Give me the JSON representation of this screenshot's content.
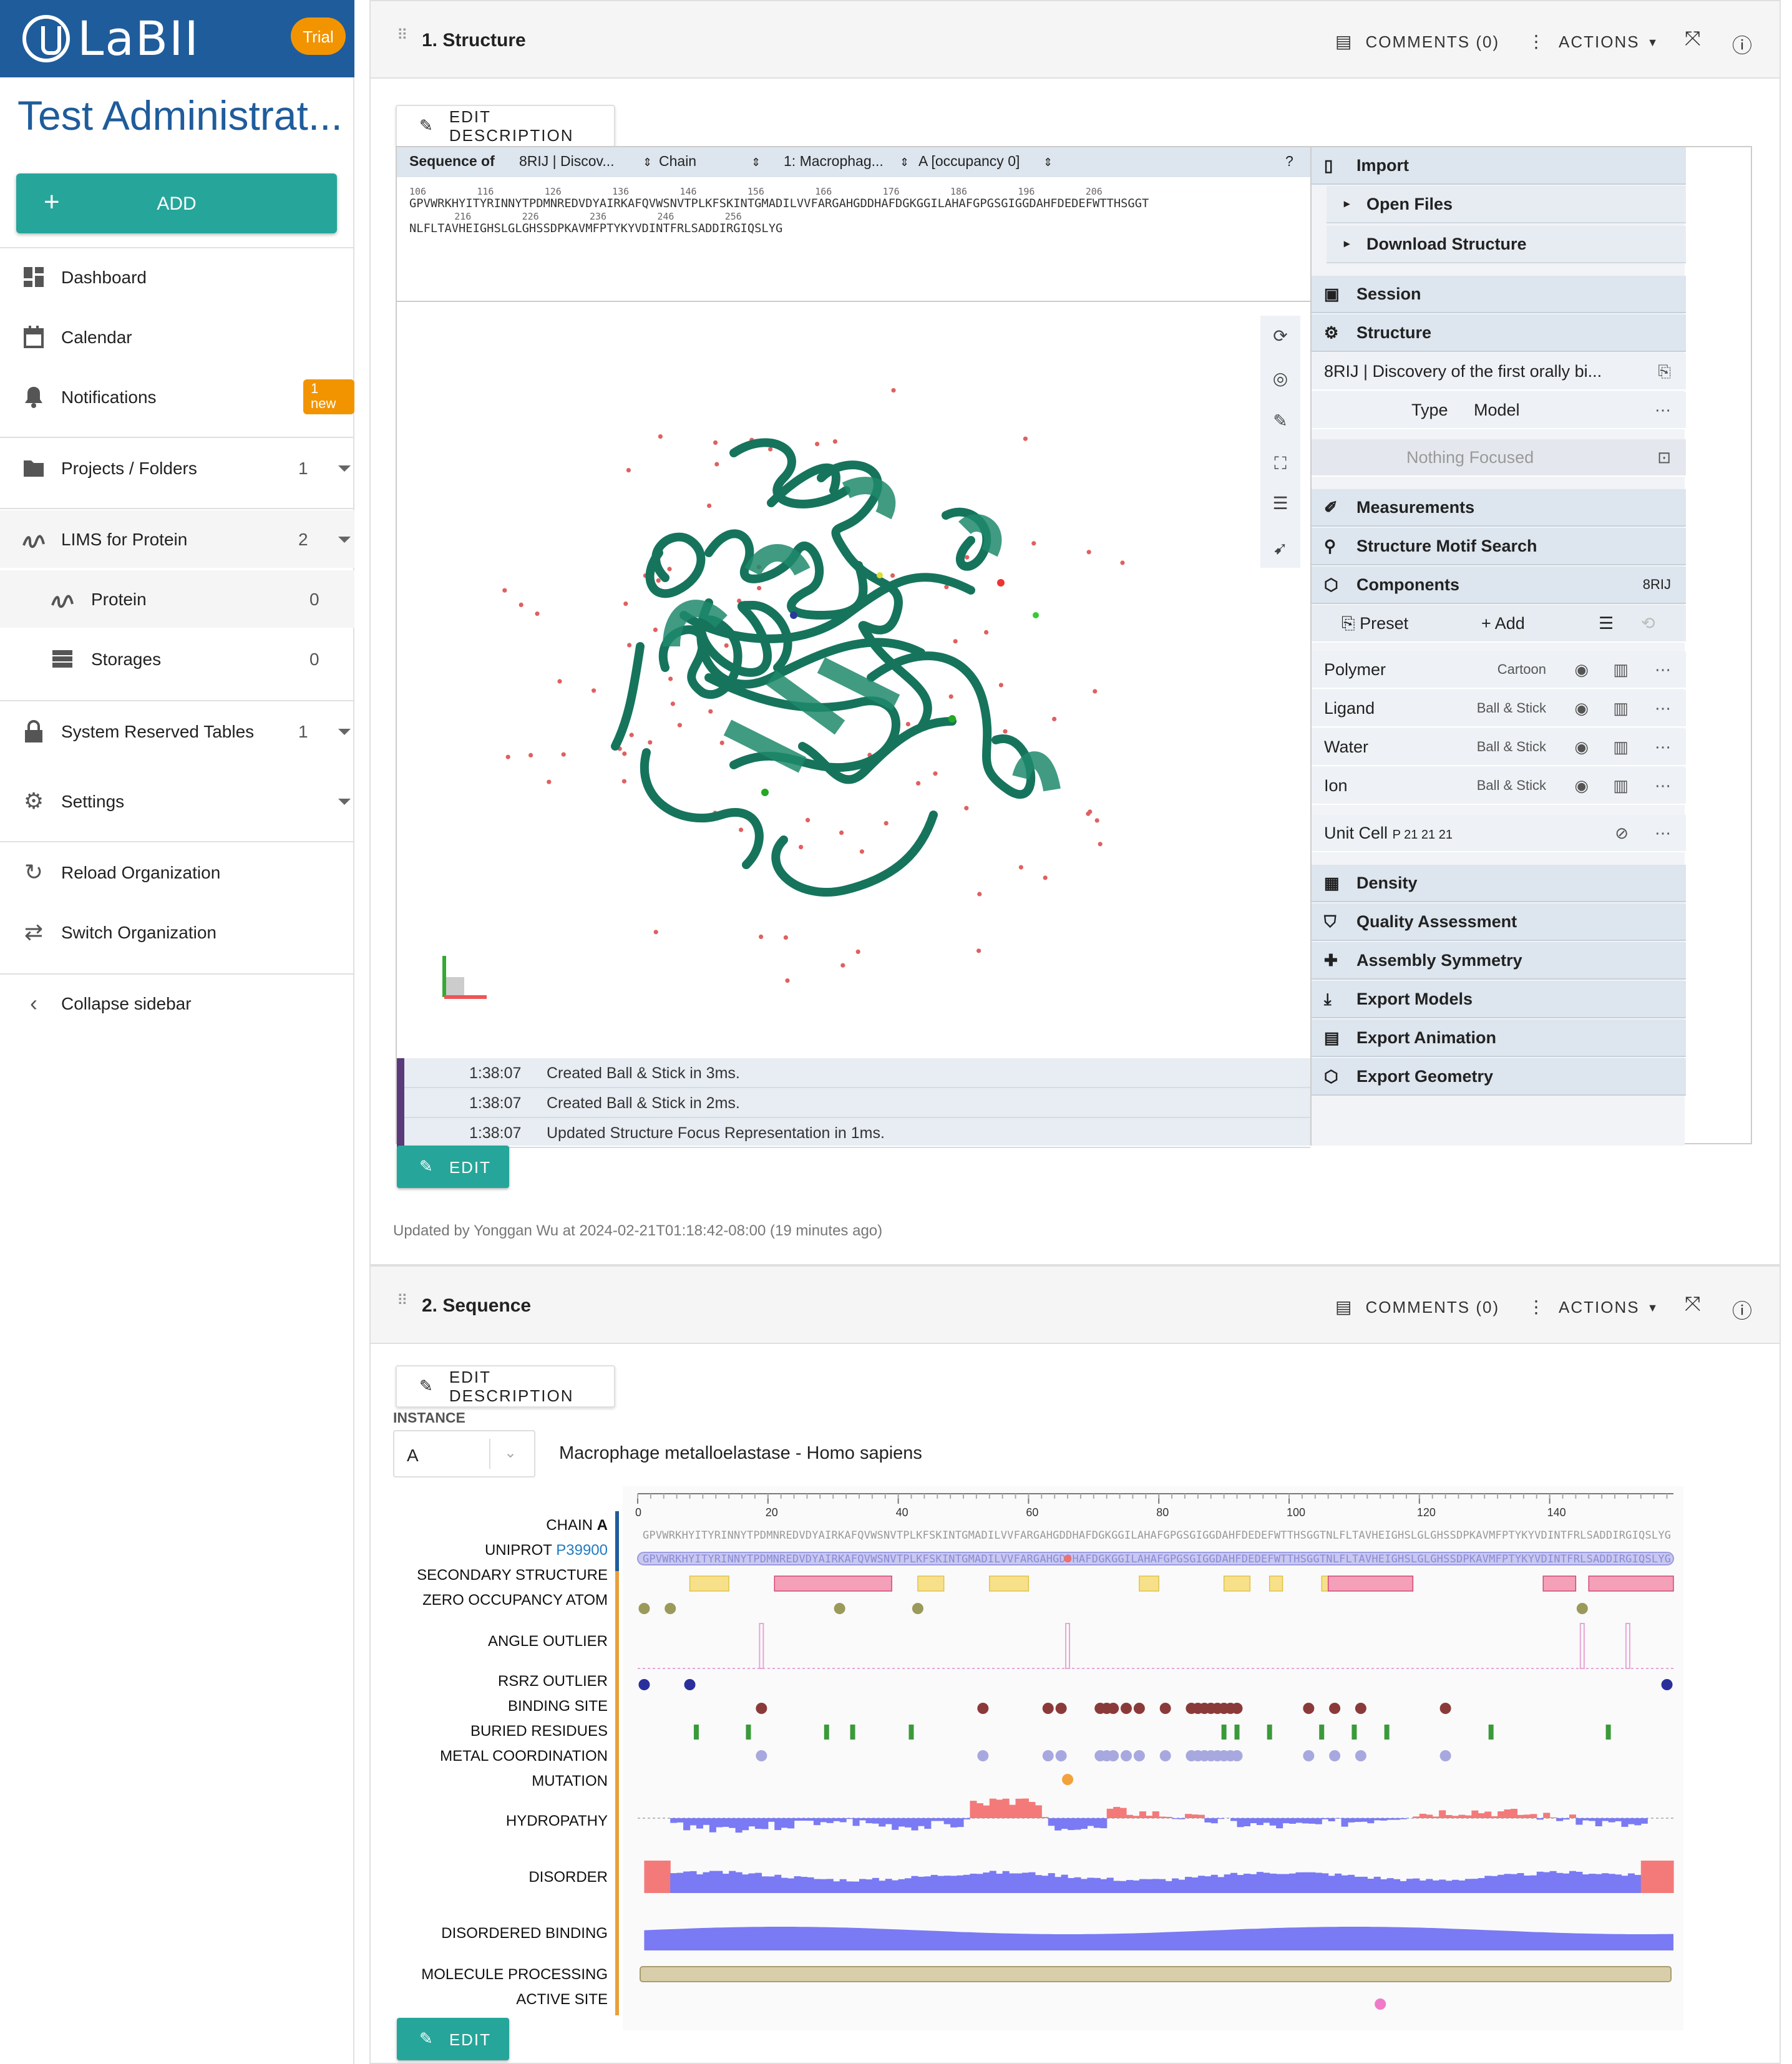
{
  "brand": {
    "logo": "LaBII",
    "trial": "Trial",
    "org_name": "Test Administrat...",
    "add": "ADD"
  },
  "nav": {
    "dashboard": "Dashboard",
    "calendar": "Calendar",
    "notifications": "Notifications",
    "notif_badge": "1 new",
    "projects": "Projects / Folders",
    "projects_count": "1",
    "lims": "LIMS for Protein",
    "lims_count": "2",
    "protein": "Protein",
    "protein_count": "0",
    "storages": "Storages",
    "storages_count": "0",
    "system": "System Reserved Tables",
    "system_count": "1",
    "settings": "Settings",
    "reload": "Reload Organization",
    "switch": "Switch Organization",
    "collapse": "Collapse sidebar"
  },
  "card1": {
    "title": "1. Structure",
    "comments": "COMMENTS (0)",
    "actions": "ACTIONS",
    "edit_desc": "EDIT DESCRIPTION",
    "edit": "EDIT",
    "updated": "Updated by Yonggan Wu at 2024-02-21T01:18:42-08:00 (19 minutes ago)",
    "seqbar": {
      "label": "Sequence of",
      "entry": "8RIJ | Discov...",
      "chain": "Chain",
      "entity": "1: Macrophag...",
      "occupancy": "A [occupancy 0]"
    },
    "seq_line1_nums": "106         116         126         136         146         156         166         176         186         196         206",
    "seq_line1": "GPVWRKHYITYRINNYTPDMNREDVDYAIRKAFQVWSNVTPLKFSKINTGMADILVVFARGAHGDDHAFDGKGGILAHAFGPGSGIGGDAHFDEDEFWTTHSGGT",
    "seq_line2_nums": "        216         226         236         246         256",
    "seq_line2": "NLFLTAVHEIGHSLGLGHSSDPKAVMFPTYKYVDINTFRLSADDIRGIQSLYG",
    "log": [
      {
        "time": "1:38:07",
        "msg": "Created Ball & Stick in 3ms."
      },
      {
        "time": "1:38:07",
        "msg": "Created Ball & Stick in 2ms."
      },
      {
        "time": "1:38:07",
        "msg": "Updated Structure Focus Representation in 1ms."
      }
    ],
    "panel": {
      "import": "Import",
      "open_files": "Open Files",
      "download": "Download Structure",
      "session": "Session",
      "structure": "Structure",
      "entry": "8RIJ | Discovery of the first orally bi...",
      "type_label": "Type",
      "type_value": "Model",
      "nothing_focused": "Nothing Focused",
      "measurements": "Measurements",
      "motif": "Structure Motif Search",
      "components": "Components",
      "components_id": "8RIJ",
      "preset": "Preset",
      "add": "Add",
      "components_list": [
        {
          "name": "Polymer",
          "repr": "Cartoon"
        },
        {
          "name": "Ligand",
          "repr": "Ball & Stick"
        },
        {
          "name": "Water",
          "repr": "Ball & Stick"
        },
        {
          "name": "Ion",
          "repr": "Ball & Stick"
        }
      ],
      "unit_cell": "Unit Cell",
      "unit_cell_group": "P 21 21 21",
      "density": "Density",
      "quality": "Quality Assessment",
      "assembly": "Assembly Symmetry",
      "export_models": "Export Models",
      "export_animation": "Export Animation",
      "export_geometry": "Export Geometry"
    }
  },
  "card2": {
    "title": "2. Sequence",
    "comments": "COMMENTS (0)",
    "actions": "ACTIONS",
    "edit_desc": "EDIT DESCRIPTION",
    "edit": "EDIT",
    "instance_label": "INSTANCE",
    "instance_value": "A",
    "protein_name": "Macrophage metalloelastase - Homo sapiens",
    "axis_ticks": [
      "0",
      "20",
      "40",
      "60",
      "80",
      "100",
      "120",
      "140"
    ],
    "sequence": "GPVWRKHYITYRINNYTPDMNREDVDYAIRKAFQVWSNVTPLKFSKINTGMADILVVFARGAHGDDHAFDGKGGILAHAFGPGSGIGGDAHFDEDEFWTTHSGGTNLFLTAVHEIGHSLGLGHSSDPKAVMFPTYKYVDINTFRLSADDIRGIQSLYG",
    "tracks": {
      "chain": "CHAIN",
      "chain_id": "A",
      "uniprot": "UNIPROT",
      "uniprot_id": "P39900",
      "secondary": "SECONDARY STRUCTURE",
      "zero_occ": "ZERO OCCUPANCY ATOM",
      "angle": "ANGLE OUTLIER",
      "rsrz": "RSRZ OUTLIER",
      "binding": "BINDING SITE",
      "buried": "BURIED RESIDUES",
      "metal": "METAL COORDINATION",
      "mutation": "MUTATION",
      "hydropathy": "HYDROPATHY",
      "disorder": "DISORDER",
      "disordered_binding": "DISORDERED BINDING",
      "processing": "MOLECULE PROCESSING",
      "active": "ACTIVE SITE"
    },
    "colors": {
      "helix": "#f4a0b8",
      "strand": "#f7e08a",
      "olive": "#9a9a5a",
      "pink": "#e7a6d6",
      "navy": "#2b2f9c",
      "maroon": "#8b3a3a",
      "green": "#3a9a3a",
      "lavender": "#a8a8e0",
      "orange": "#f2a23a",
      "hydro_pos": "#f47a7a",
      "hydro_neg": "#7a7af4",
      "beige": "#d8cfaa",
      "magenta": "#f07ac8"
    }
  }
}
